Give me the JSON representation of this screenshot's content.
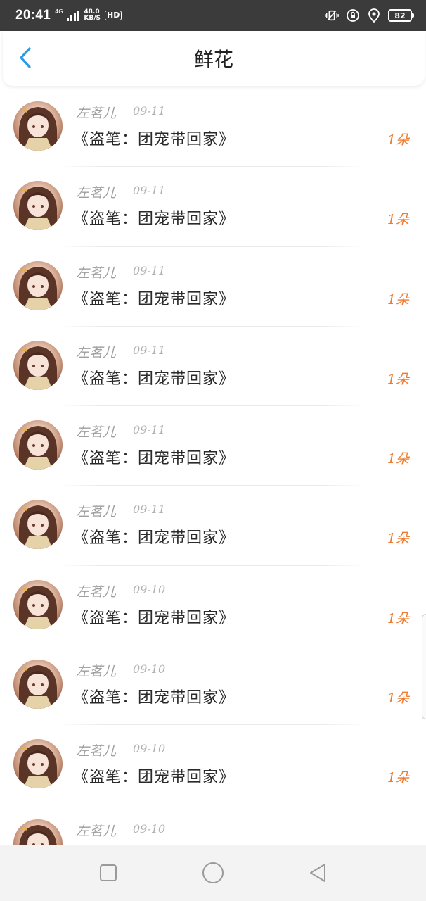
{
  "status_bar": {
    "time": "20:41",
    "network": "4G",
    "speed_value": "48.0",
    "speed_unit": "KB/S",
    "hd": "HD",
    "battery": "82"
  },
  "header": {
    "title": "鲜花"
  },
  "colors": {
    "accent_blue": "#2a9ae6",
    "count_orange": "#f07a2e"
  },
  "items": [
    {
      "name": "左茗儿",
      "date": "09-11",
      "book": "《盗笔：团宠带回家》",
      "count": "1朵"
    },
    {
      "name": "左茗儿",
      "date": "09-11",
      "book": "《盗笔：团宠带回家》",
      "count": "1朵"
    },
    {
      "name": "左茗儿",
      "date": "09-11",
      "book": "《盗笔：团宠带回家》",
      "count": "1朵"
    },
    {
      "name": "左茗儿",
      "date": "09-11",
      "book": "《盗笔：团宠带回家》",
      "count": "1朵"
    },
    {
      "name": "左茗儿",
      "date": "09-11",
      "book": "《盗笔：团宠带回家》",
      "count": "1朵"
    },
    {
      "name": "左茗儿",
      "date": "09-11",
      "book": "《盗笔：团宠带回家》",
      "count": "1朵"
    },
    {
      "name": "左茗儿",
      "date": "09-10",
      "book": "《盗笔：团宠带回家》",
      "count": "1朵"
    },
    {
      "name": "左茗儿",
      "date": "09-10",
      "book": "《盗笔：团宠带回家》",
      "count": "1朵"
    },
    {
      "name": "左茗儿",
      "date": "09-10",
      "book": "《盗笔：团宠带回家》",
      "count": "1朵"
    },
    {
      "name": "左茗儿",
      "date": "09-10",
      "book": "",
      "count": ""
    }
  ]
}
